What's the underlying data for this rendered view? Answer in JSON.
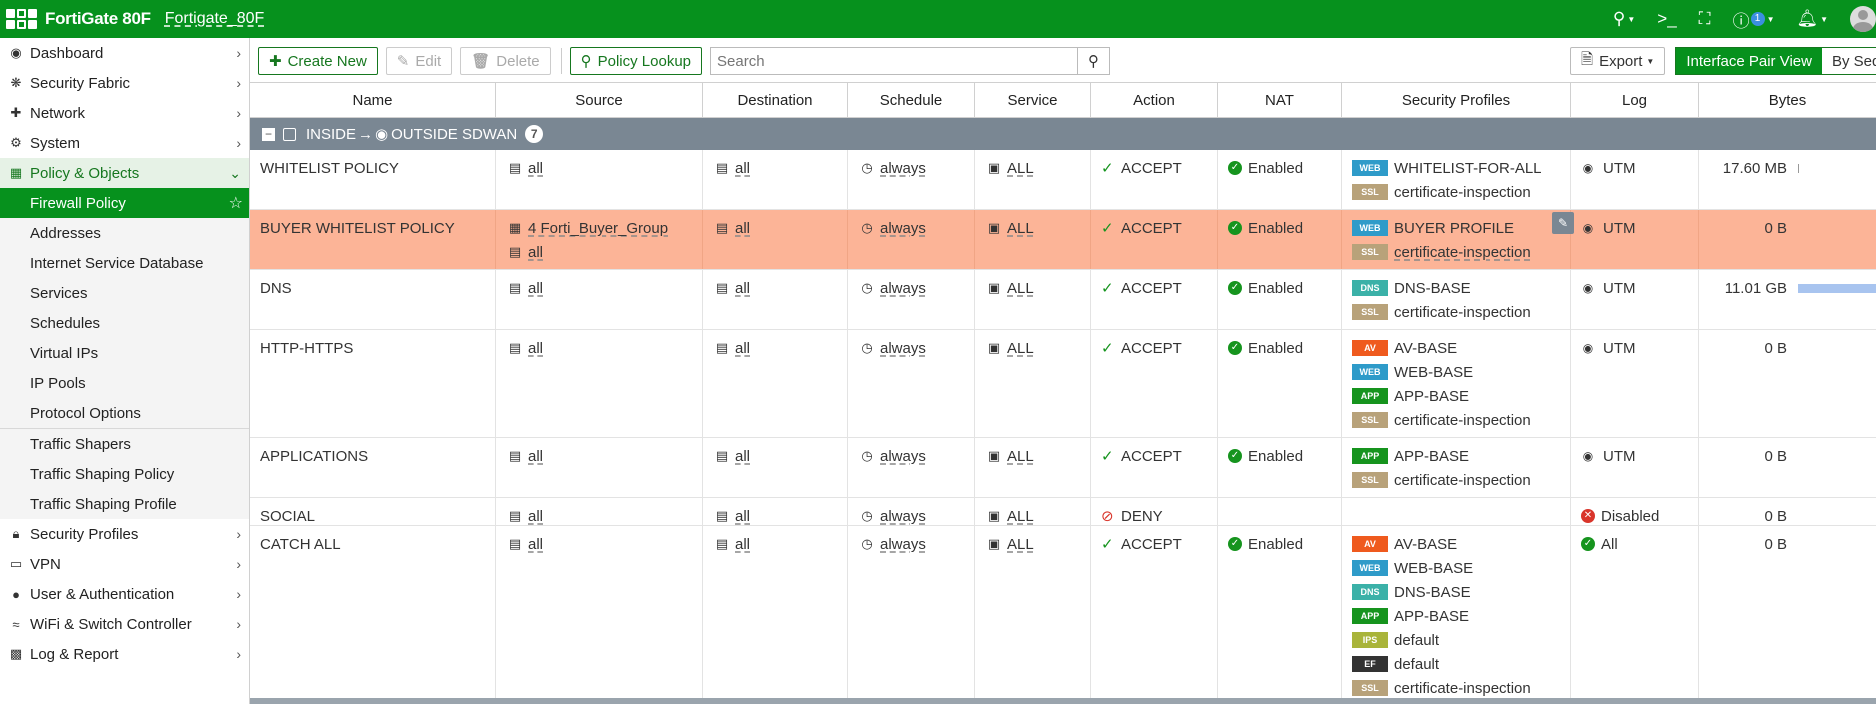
{
  "header": {
    "brand": "FortiGate 80F",
    "hostname": "Fortigate_80F",
    "help_badge": "1"
  },
  "sidebar": {
    "items": [
      {
        "label": "Dashboard",
        "icon": "dashboard-icon"
      },
      {
        "label": "Security Fabric",
        "icon": "fabric-icon"
      },
      {
        "label": "Network",
        "icon": "network-icon"
      },
      {
        "label": "System",
        "icon": "gear-icon"
      },
      {
        "label": "Policy & Objects",
        "icon": "policy-icon"
      },
      {
        "label": "Security Profiles",
        "icon": "lock-icon"
      },
      {
        "label": "VPN",
        "icon": "laptop-icon"
      },
      {
        "label": "User & Authentication",
        "icon": "user-icon"
      },
      {
        "label": "WiFi & Switch Controller",
        "icon": "wifi-icon"
      },
      {
        "label": "Log & Report",
        "icon": "chart-icon"
      }
    ],
    "sub_items": [
      "Firewall Policy",
      "Addresses",
      "Internet Service Database",
      "Services",
      "Schedules",
      "Virtual IPs",
      "IP Pools",
      "Protocol Options",
      "Traffic Shapers",
      "Traffic Shaping Policy",
      "Traffic Shaping Profile"
    ]
  },
  "toolbar": {
    "create_new": "Create New",
    "edit": "Edit",
    "delete": "Delete",
    "policy_lookup": "Policy Lookup",
    "search_placeholder": "Search",
    "export": "Export",
    "interface_pair_view": "Interface Pair View",
    "by_sequence": "By Seque"
  },
  "table": {
    "columns": [
      "Name",
      "Source",
      "Destination",
      "Schedule",
      "Service",
      "Action",
      "NAT",
      "Security Profiles",
      "Log",
      "Bytes"
    ],
    "group": {
      "from": "INSIDE",
      "arrow": "→",
      "to": "OUTSIDE SDWAN",
      "count": "7"
    },
    "rows": [
      {
        "name": "WHITELIST POLICY",
        "source": [
          "all"
        ],
        "dest": "all",
        "schedule": "always",
        "service": "ALL",
        "action": "ACCEPT",
        "nat": "Enabled",
        "profiles": [
          {
            "tag": "WEB",
            "name": "WHITELIST-FOR-ALL"
          },
          {
            "tag": "SSL",
            "name": "certificate-inspection"
          }
        ],
        "log": "UTM",
        "bytes": "17.60 MB"
      },
      {
        "name": "BUYER WHITELIST POLICY",
        "source": [
          "4 Forti_Buyer_Group",
          "all"
        ],
        "dest": "all",
        "schedule": "always",
        "service": "ALL",
        "action": "ACCEPT",
        "nat": "Enabled",
        "profiles": [
          {
            "tag": "WEB",
            "name": "BUYER PROFILE"
          },
          {
            "tag": "SSL",
            "name": "certificate-inspection"
          }
        ],
        "log": "UTM",
        "bytes": "0 B"
      },
      {
        "name": "DNS",
        "source": [
          "all"
        ],
        "dest": "all",
        "schedule": "always",
        "service": "ALL",
        "action": "ACCEPT",
        "nat": "Enabled",
        "profiles": [
          {
            "tag": "DNS",
            "name": "DNS-BASE"
          },
          {
            "tag": "SSL",
            "name": "certificate-inspection"
          }
        ],
        "log": "UTM",
        "bytes": "11.01 GB"
      },
      {
        "name": "HTTP-HTTPS",
        "source": [
          "all"
        ],
        "dest": "all",
        "schedule": "always",
        "service": "ALL",
        "action": "ACCEPT",
        "nat": "Enabled",
        "profiles": [
          {
            "tag": "AV",
            "name": "AV-BASE"
          },
          {
            "tag": "WEB",
            "name": "WEB-BASE"
          },
          {
            "tag": "APP",
            "name": "APP-BASE"
          },
          {
            "tag": "SSL",
            "name": "certificate-inspection"
          }
        ],
        "log": "UTM",
        "bytes": "0 B"
      },
      {
        "name": "APPLICATIONS",
        "source": [
          "all"
        ],
        "dest": "all",
        "schedule": "always",
        "service": "ALL",
        "action": "ACCEPT",
        "nat": "Enabled",
        "profiles": [
          {
            "tag": "APP",
            "name": "APP-BASE"
          },
          {
            "tag": "SSL",
            "name": "certificate-inspection"
          }
        ],
        "log": "UTM",
        "bytes": "0 B"
      },
      {
        "name": "SOCIAL",
        "source": [
          "all"
        ],
        "dest": "all",
        "schedule": "always",
        "service": "ALL",
        "action": "DENY",
        "nat": "",
        "profiles": [],
        "log": "Disabled",
        "bytes": "0 B"
      },
      {
        "name": "CATCH ALL",
        "source": [
          "all"
        ],
        "dest": "all",
        "schedule": "always",
        "service": "ALL",
        "action": "ACCEPT",
        "nat": "Enabled",
        "profiles": [
          {
            "tag": "AV",
            "name": "AV-BASE"
          },
          {
            "tag": "WEB",
            "name": "WEB-BASE"
          },
          {
            "tag": "DNS",
            "name": "DNS-BASE"
          },
          {
            "tag": "APP",
            "name": "APP-BASE"
          },
          {
            "tag": "IPS",
            "name": "default"
          },
          {
            "tag": "EF",
            "name": "default"
          },
          {
            "tag": "SSL",
            "name": "certificate-inspection"
          }
        ],
        "log": "All",
        "bytes": "0 B"
      }
    ]
  },
  "colors": {
    "brand_green": "#06911d",
    "highlight_row": "#fcb497",
    "group_bar": "#7a8793",
    "tag_web": "#2e9bc9",
    "tag_ssl": "#b8a27a",
    "tag_dns": "#3bb1a8",
    "tag_av": "#ef5a1e",
    "tag_app": "#16941e",
    "tag_ips": "#a9b43a",
    "tag_ef": "#333333"
  }
}
